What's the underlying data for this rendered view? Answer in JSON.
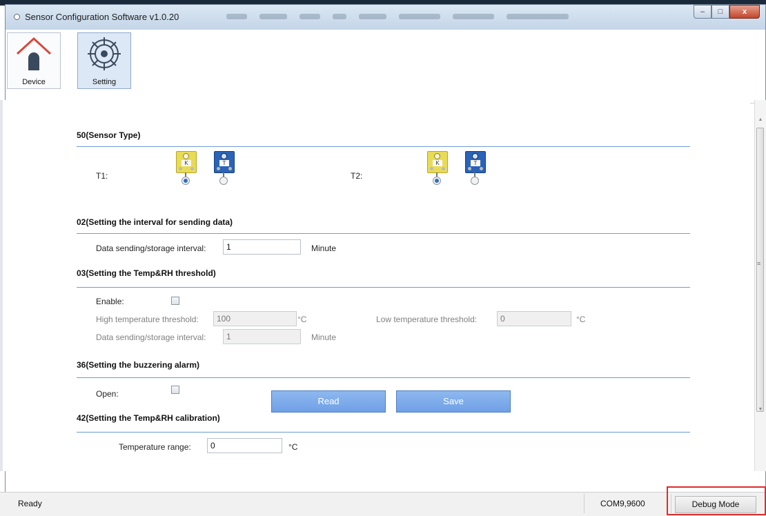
{
  "window": {
    "title": "Sensor Configuration Software v1.0.20",
    "controls": {
      "minimize": "–",
      "maximize": "□",
      "close": "x"
    }
  },
  "toolbar": {
    "device_label": "Device",
    "setting_label": "Setting",
    "active": "Setting"
  },
  "sensor_type": {
    "title": "50(Sensor Type)",
    "t1_label": "T1:",
    "t2_label": "T2:",
    "k_tag": "K",
    "t_tag": "T",
    "t1_selected": "K",
    "t2_selected": "K"
  },
  "interval": {
    "title": "02(Setting the interval for sending data)",
    "label": "Data sending/storage interval:",
    "value": "1",
    "unit": "Minute"
  },
  "threshold": {
    "title": "03(Setting the Temp&RH threshold)",
    "enable_label": "Enable:",
    "enable_checked": false,
    "high_label": "High temperature threshold:",
    "high_value": "100",
    "high_unit": "°C",
    "low_label": "Low temperature threshold:",
    "low_value": "0",
    "low_unit": "°C",
    "interval_label": "Data sending/storage interval:",
    "interval_value": "1",
    "interval_unit": "Minute"
  },
  "buzzer": {
    "title": "36(Setting the buzzering alarm)",
    "open_label": "Open:",
    "open_checked": false
  },
  "calibration": {
    "title": "42(Setting the Temp&RH calibration)",
    "temp_label": "Temperature range:",
    "temp_value": "0",
    "temp_unit": "°C"
  },
  "actions": {
    "read": "Read",
    "save": "Save"
  },
  "status": {
    "ready": "Ready",
    "port": "COM9,9600",
    "debug": "Debug Mode"
  },
  "colors": {
    "accent": "#6fa0e6",
    "section_line": "#6f9ad6",
    "highlight": "#e02a2a"
  }
}
